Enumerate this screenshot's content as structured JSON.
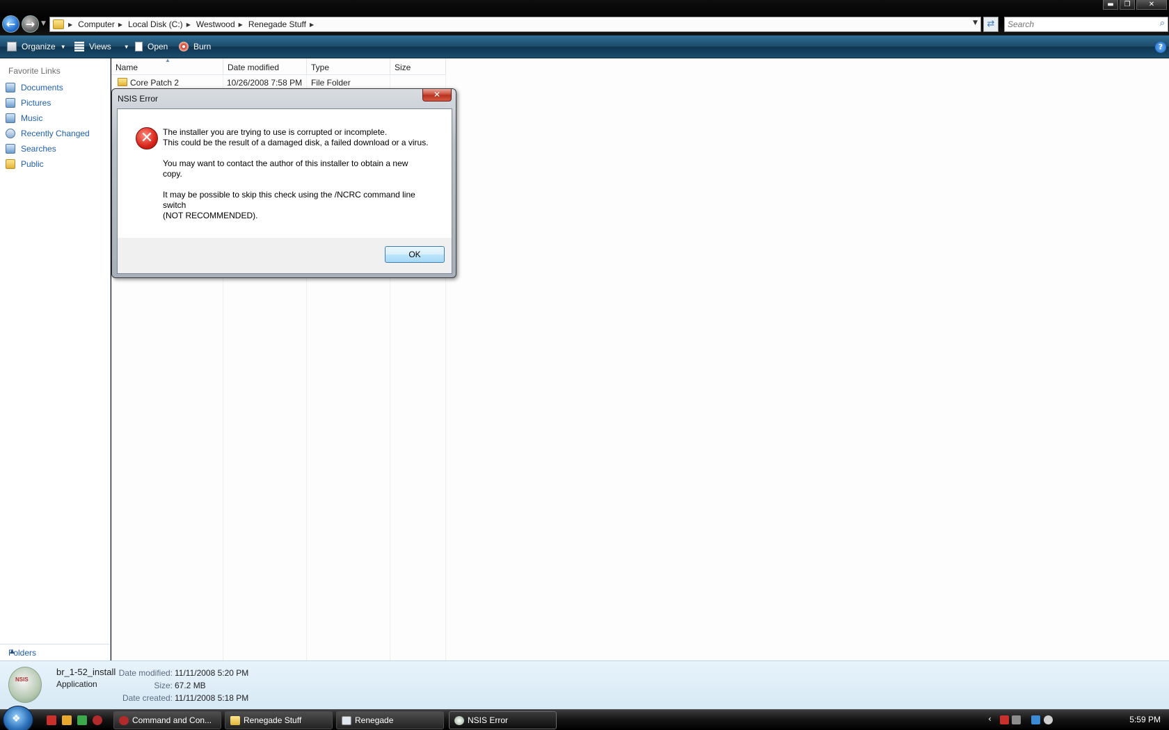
{
  "window": {
    "controls": {
      "minimize": "▬",
      "maximize": "❐",
      "close": "✕"
    }
  },
  "address_bar": {
    "crumbs": [
      "Computer",
      "Local Disk (C:)",
      "Westwood",
      "Renegade Stuff"
    ],
    "search_placeholder": "Search"
  },
  "toolbar": {
    "organize": "Organize",
    "views": "Views",
    "open": "Open",
    "burn": "Burn",
    "help": "?"
  },
  "nav_pane": {
    "header": "Favorite Links",
    "items": [
      {
        "label": "Documents",
        "icon": "documents-icon"
      },
      {
        "label": "Pictures",
        "icon": "pictures-icon"
      },
      {
        "label": "Music",
        "icon": "music-icon"
      },
      {
        "label": "Recently Changed",
        "icon": "recently-changed-icon"
      },
      {
        "label": "Searches",
        "icon": "searches-icon"
      },
      {
        "label": "Public",
        "icon": "public-folder-icon"
      }
    ],
    "folders_label": "Folders"
  },
  "file_list": {
    "columns": [
      "Name",
      "Date modified",
      "Type",
      "Size"
    ],
    "rows": [
      {
        "name": "Core Patch 2",
        "date": "10/26/2008 7:58 PM",
        "type": "File Folder",
        "size": ""
      }
    ]
  },
  "dialog": {
    "title": "NSIS Error",
    "close": "✕",
    "lines": {
      "l1": "The installer you are trying to use is corrupted or incomplete.",
      "l2": "This could be the result of a damaged disk, a failed download or a virus.",
      "l3": "You may want to contact the author of this installer to obtain a new",
      "l4": "copy.",
      "l5": "It may be possible to skip this check using the /NCRC command line",
      "l6": "switch",
      "l7": "(NOT RECOMMENDED)."
    },
    "ok": "OK"
  },
  "details": {
    "icon_text": "NSIS",
    "name": "br_1-52_install",
    "kind": "Application",
    "date_modified_label": "Date modified:",
    "date_modified": "11/11/2008 5:20 PM",
    "size_label": "Size:",
    "size": "67.2 MB",
    "date_created_label": "Date created:",
    "date_created": "11/11/2008 5:18 PM"
  },
  "taskbar": {
    "buttons": [
      "Command and Con...",
      "Renegade Stuff",
      "Renegade",
      "NSIS Error"
    ],
    "clock": "5:59 PM"
  },
  "colors": {
    "link_blue": "#1e5fb2",
    "command_bar": "#1d4a6a",
    "error_red": "#d7251a"
  }
}
